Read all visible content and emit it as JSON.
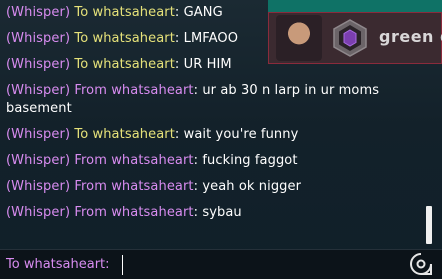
{
  "overlay": {
    "player_name": "green d"
  },
  "messages": [
    {
      "tag": "(Whisper)",
      "direction": "To",
      "name": "whatsaheart",
      "text": ": GANG"
    },
    {
      "tag": "(Whisper)",
      "direction": "To",
      "name": "whatsaheart",
      "text": ": LMFAOO"
    },
    {
      "tag": "(Whisper)",
      "direction": "To",
      "name": "whatsaheart",
      "text": ": UR HIM"
    },
    {
      "tag": "(Whisper)",
      "direction": "From",
      "name": "whatsaheart",
      "text": ": ur ab 30 n larp in ur moms basement"
    },
    {
      "tag": "(Whisper)",
      "direction": "To",
      "name": "whatsaheart",
      "text": ": wait you're funny"
    },
    {
      "tag": "(Whisper)",
      "direction": "From",
      "name": "whatsaheart",
      "text": ": fucking faggot"
    },
    {
      "tag": "(Whisper)",
      "direction": "From",
      "name": "whatsaheart",
      "text": ": yeah ok nigger"
    },
    {
      "tag": "(Whisper)",
      "direction": "From",
      "name": "whatsaheart",
      "text": ": sybau"
    }
  ],
  "input": {
    "prefix": "To whatsaheart:",
    "value": ""
  },
  "icons": {
    "emote": "emote-icon",
    "rank": "rank-icon"
  },
  "colors": {
    "whisper_purple": "#d88cf0",
    "to_yellow": "#e6e27a",
    "message_white": "#ffffff"
  }
}
